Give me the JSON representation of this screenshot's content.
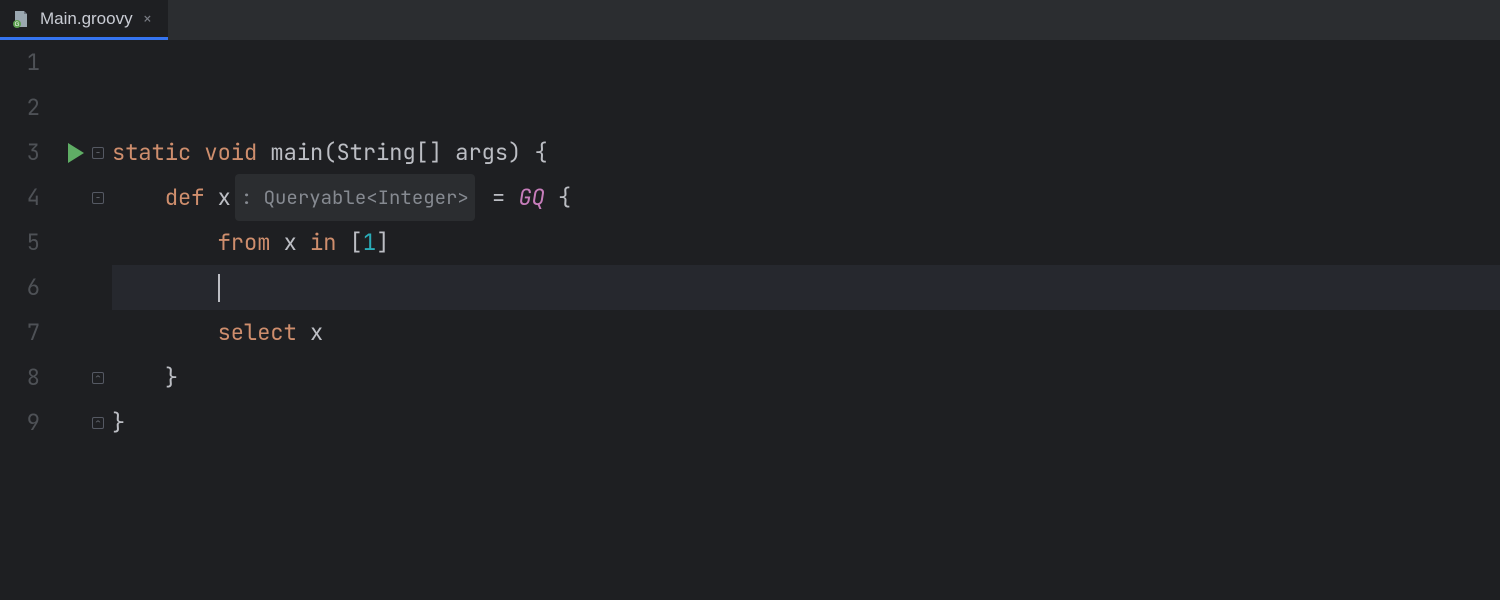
{
  "tab": {
    "label": "Main.groovy",
    "icon": "groovy-file-icon",
    "close": "×",
    "active": true
  },
  "gutter": {
    "lines": [
      "1",
      "2",
      "3",
      "4",
      "5",
      "6",
      "7",
      "8",
      "9"
    ],
    "run_on_line": 3
  },
  "code": {
    "lines": [
      {
        "n": 1,
        "tokens": []
      },
      {
        "n": 2,
        "tokens": []
      },
      {
        "n": 3,
        "tokens": [
          {
            "t": "static ",
            "c": "tok-kw"
          },
          {
            "t": "void ",
            "c": "tok-kw"
          },
          {
            "t": "main",
            "c": "tok-ident"
          },
          {
            "t": "(",
            "c": "tok-punc"
          },
          {
            "t": "String",
            "c": "tok-type"
          },
          {
            "t": "[] ",
            "c": "tok-punc"
          },
          {
            "t": "args",
            "c": "tok-ident"
          },
          {
            "t": ") {",
            "c": "tok-punc"
          }
        ],
        "fold": "open"
      },
      {
        "n": 4,
        "indent": 1,
        "tokens": [
          {
            "t": "def ",
            "c": "tok-kw"
          },
          {
            "t": "x",
            "c": "tok-ident"
          },
          {
            "inlay": ": Queryable<Integer>"
          },
          {
            "t": " = ",
            "c": "tok-punc"
          },
          {
            "t": "GQ",
            "c": "tok-gq"
          },
          {
            "t": " {",
            "c": "tok-punc"
          }
        ],
        "fold": "open"
      },
      {
        "n": 5,
        "indent": 2,
        "tokens": [
          {
            "t": "from ",
            "c": "tok-kw"
          },
          {
            "t": "x ",
            "c": "tok-ident"
          },
          {
            "t": "in ",
            "c": "tok-kw"
          },
          {
            "t": "[",
            "c": "tok-punc"
          },
          {
            "t": "1",
            "c": "tok-num"
          },
          {
            "t": "]",
            "c": "tok-punc"
          }
        ]
      },
      {
        "n": 6,
        "indent": 2,
        "current": true,
        "caret": true,
        "tokens": []
      },
      {
        "n": 7,
        "indent": 2,
        "tokens": [
          {
            "t": "select ",
            "c": "tok-kw"
          },
          {
            "t": "x",
            "c": "tok-ident"
          }
        ]
      },
      {
        "n": 8,
        "indent": 1,
        "tokens": [
          {
            "t": "}",
            "c": "tok-punc"
          }
        ],
        "fold": "close"
      },
      {
        "n": 9,
        "tokens": [
          {
            "t": "}",
            "c": "tok-punc"
          }
        ],
        "fold": "close"
      }
    ],
    "indent_unit": "    "
  },
  "hint_inlay_text": ": Queryable<Integer>",
  "colors": {
    "keyword": "#cf8e6d",
    "number": "#2aacb8",
    "identifier": "#bcbec4",
    "inlay": "#868a91",
    "gq": "#c77dbb",
    "tab_underline": "#3574f0",
    "run": "#5fad65",
    "bg": "#1e1f22"
  }
}
